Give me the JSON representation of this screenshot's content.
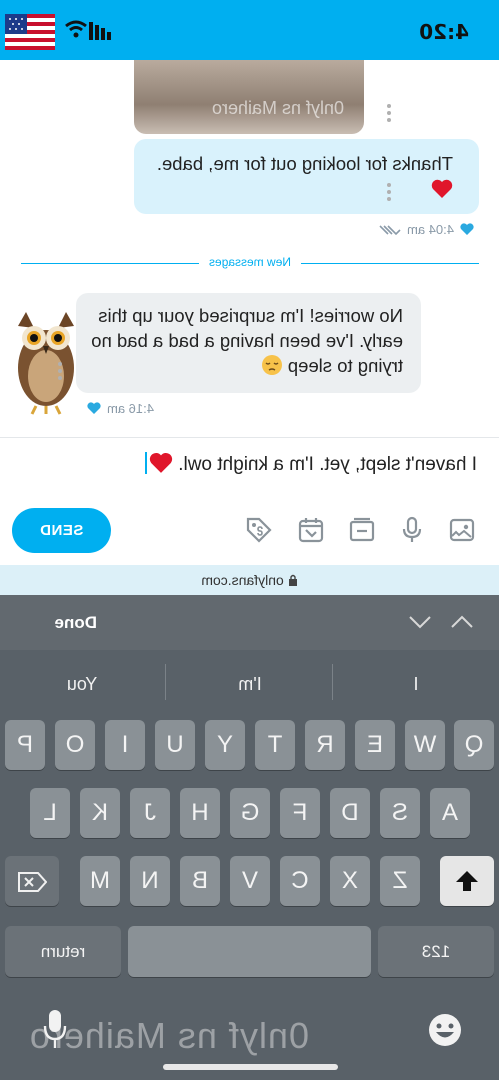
{
  "status_bar": {
    "time": "4:20"
  },
  "chat": {
    "photo_watermark": "0nlyf ns Maihero",
    "sent_message": {
      "text": "Thanks for looking out for me, babe. ",
      "time": "4:04 am"
    },
    "new_messages_label": "New messages",
    "received_message": {
      "text": "No worries! I'm surprised your up this early. I've been having a bad a bad no trying to sleep ",
      "time": "4:16 am"
    }
  },
  "composer": {
    "value": "I haven't slept, yet. I'm a knight owl. ",
    "send_label": "SEND"
  },
  "browser": {
    "url": "onlyfans.com"
  },
  "keyboard": {
    "done_label": "Done",
    "suggestions": [
      "I",
      "I'm",
      "You"
    ],
    "row1": [
      "Q",
      "W",
      "E",
      "R",
      "T",
      "Y",
      "U",
      "I",
      "O",
      "P"
    ],
    "row2": [
      "A",
      "S",
      "D",
      "F",
      "G",
      "H",
      "J",
      "K",
      "L"
    ],
    "row3": [
      "Z",
      "X",
      "C",
      "V",
      "B",
      "N",
      "M"
    ],
    "numbers_label": "123",
    "return_label": "return",
    "watermark": "0nlyf ns Maihero"
  },
  "colors": {
    "accent": "#00aff0",
    "bubble_out": "#d9f2fc",
    "bubble_in": "#eceff1",
    "heart": "#e0162b",
    "keyboard": "#596168"
  }
}
